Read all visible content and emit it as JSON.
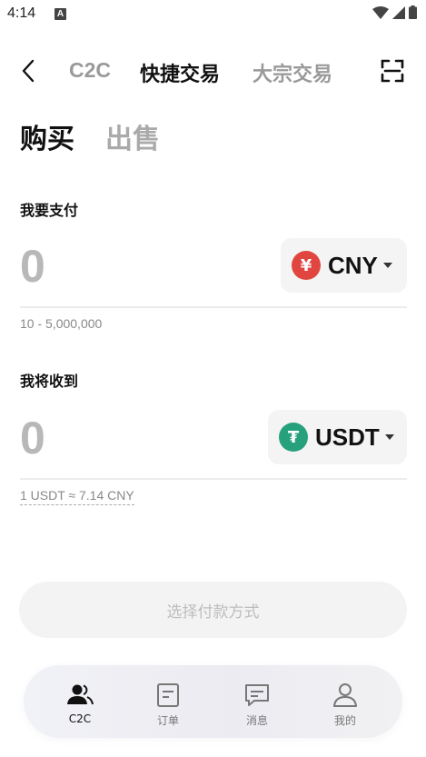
{
  "status": {
    "time": "4:14",
    "notif": "A"
  },
  "header": {
    "tabs": [
      {
        "label": "C2C"
      },
      {
        "label": "快捷交易"
      },
      {
        "label": "大宗交易"
      }
    ]
  },
  "modes": {
    "buy": "购买",
    "sell": "出售"
  },
  "pay": {
    "label": "我要支付",
    "amount": "0",
    "currency": "CNY",
    "currency_symbol": "¥",
    "currency_color": "#e0463f",
    "range": "10 - 5,000,000"
  },
  "receive": {
    "label": "我将收到",
    "amount": "0",
    "currency": "USDT",
    "currency_symbol": "₮",
    "currency_color": "#26a17b",
    "rate": "1 USDT ≈ 7.14 CNY"
  },
  "pay_method_button": "选择付款方式",
  "bottom_nav": [
    {
      "label": "C2C",
      "icon": "user-group-icon",
      "active": true
    },
    {
      "label": "订单",
      "icon": "order-icon",
      "active": false
    },
    {
      "label": "消息",
      "icon": "message-icon",
      "active": false
    },
    {
      "label": "我的",
      "icon": "profile-icon",
      "active": false
    }
  ]
}
